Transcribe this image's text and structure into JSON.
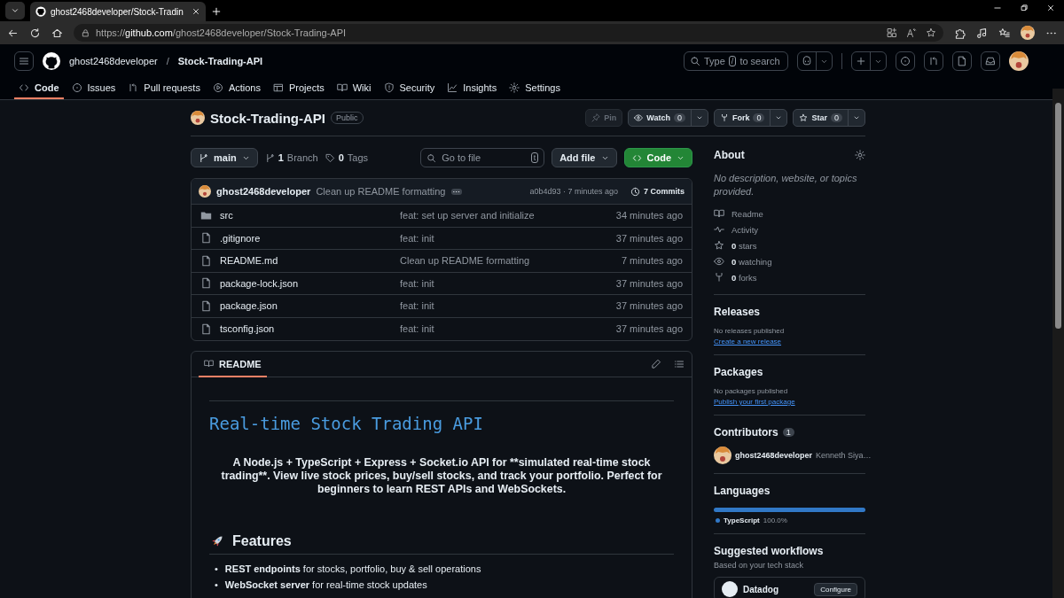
{
  "browser": {
    "tab_title": "ghost2468developer/Stock-Tradin",
    "url_scheme": "https://",
    "url_host": "github.com",
    "url_path": "/ghost2468developer/Stock-Trading-API"
  },
  "header": {
    "owner": "ghost2468developer",
    "separator": "/",
    "repo": "Stock-Trading-API",
    "search_before": "Type",
    "search_key": "/",
    "search_after": "to search"
  },
  "repo_tabs": [
    {
      "label": "Code",
      "selected": true
    },
    {
      "label": "Issues",
      "selected": false
    },
    {
      "label": "Pull requests",
      "selected": false
    },
    {
      "label": "Actions",
      "selected": false
    },
    {
      "label": "Projects",
      "selected": false
    },
    {
      "label": "Wiki",
      "selected": false
    },
    {
      "label": "Security",
      "selected": false
    },
    {
      "label": "Insights",
      "selected": false
    },
    {
      "label": "Settings",
      "selected": false
    }
  ],
  "repo": {
    "name": "Stock-Trading-API",
    "visibility": "Public",
    "actions": [
      {
        "kind": "pin",
        "label": "Pin",
        "disabled": true
      },
      {
        "kind": "eye",
        "label": "Watch",
        "count": "0",
        "disabled": false
      },
      {
        "kind": "fork",
        "label": "Fork",
        "count": "0",
        "disabled": false
      },
      {
        "kind": "star",
        "label": "Star",
        "count": "0",
        "disabled": false
      }
    ]
  },
  "toolbar": {
    "branch": "main",
    "branch_count": "1",
    "branch_label": "Branch",
    "tag_count": "0",
    "tag_label": "Tags",
    "goto_placeholder": "Go to file",
    "goto_key": "t",
    "add_file": "Add file",
    "code": "Code"
  },
  "commit": {
    "author": "ghost2468developer",
    "message": "Clean up README formatting",
    "meta": "a0b4d93 · 7 minutes ago",
    "commits": "7 Commits"
  },
  "files": [
    {
      "kind": "folder",
      "name": "src",
      "message": "feat: set up server and initialize",
      "age": "34 minutes ago"
    },
    {
      "kind": "file",
      "name": ".gitignore",
      "message": "feat: init",
      "age": "37 minutes ago"
    },
    {
      "kind": "file",
      "name": "README.md",
      "message": "Clean up README formatting",
      "age": "7 minutes ago"
    },
    {
      "kind": "file",
      "name": "package-lock.json",
      "message": "feat: init",
      "age": "37 minutes ago"
    },
    {
      "kind": "file",
      "name": "package.json",
      "message": "feat: init",
      "age": "37 minutes ago"
    },
    {
      "kind": "file",
      "name": "tsconfig.json",
      "message": "feat: init",
      "age": "37 minutes ago"
    }
  ],
  "readme": {
    "tab": "README",
    "title": "Real-time Stock Trading API",
    "intro": "A Node.js + TypeScript + Express + Socket.io API for **simulated real-time stock trading**. View live stock prices, buy/sell stocks, and track your portfolio. Perfect for beginners to learn REST APIs and WebSockets.",
    "features_heading": "Features",
    "features": [
      {
        "marker": "•",
        "text": "**REST endpoints** for stocks, portfolio, buy & sell operations"
      },
      {
        "marker": "•",
        "text": "**WebSocket server** for real-time stock updates"
      }
    ]
  },
  "about": {
    "heading": "About",
    "description": "No description, website, or topics provided.",
    "stats": [
      {
        "kind": "readme",
        "label": "Readme"
      },
      {
        "kind": "activity",
        "label": "Activity"
      },
      {
        "kind": "star",
        "label": "**0** stars"
      },
      {
        "kind": "eye",
        "label": "**0** watching"
      },
      {
        "kind": "fork",
        "label": "**0** forks"
      }
    ]
  },
  "releases": {
    "heading": "Releases",
    "note": "No releases published",
    "link": "Create a new release"
  },
  "packages": {
    "heading": "Packages",
    "note": "No packages published",
    "link": "Publish your first package"
  },
  "contributors": {
    "heading": "Contributors",
    "count": "1",
    "items": [
      {
        "login": "ghost2468developer",
        "name": "Kenneth Siya…"
      }
    ]
  },
  "languages": {
    "heading": "Languages",
    "items": [
      {
        "name": "TypeScript",
        "percent": "100.0%",
        "color": "#3178c6",
        "level": 1
      }
    ]
  },
  "workflows": {
    "heading": "Suggested workflows",
    "subtitle": "Based on your tech stack",
    "items": [
      {
        "name": "Datadog",
        "button": "Configure"
      }
    ]
  }
}
